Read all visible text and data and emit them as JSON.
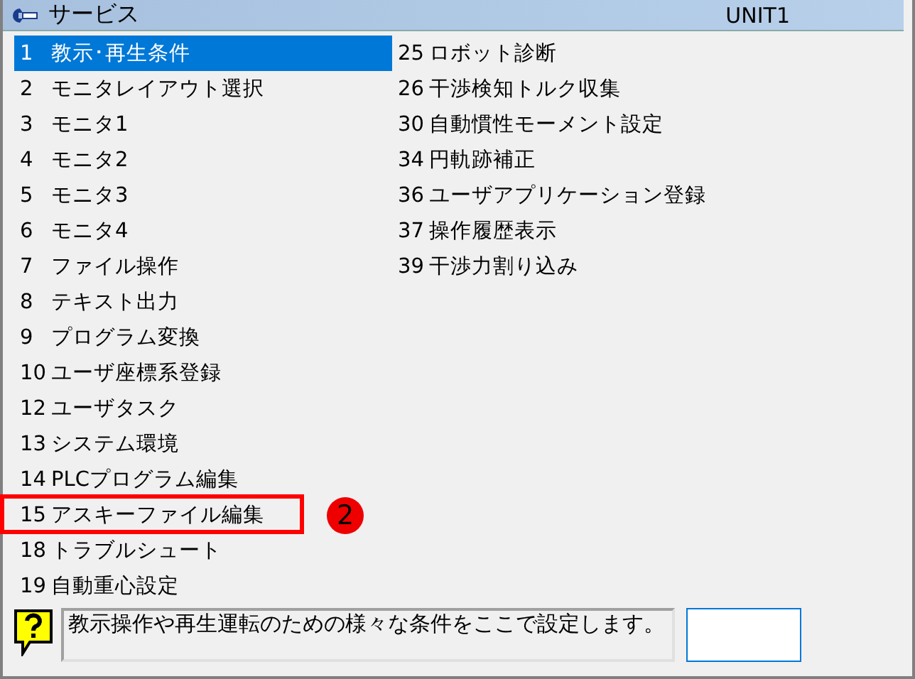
{
  "window": {
    "title": "サービス",
    "unit": "UNIT1"
  },
  "menu": {
    "columns": [
      [
        {
          "number": "1",
          "label": "教示･再生条件",
          "selected": true,
          "annotated": false
        },
        {
          "number": "2",
          "label": "モニタレイアウト選択",
          "selected": false,
          "annotated": false
        },
        {
          "number": "3",
          "label": "モニタ1",
          "selected": false,
          "annotated": false
        },
        {
          "number": "4",
          "label": "モニタ2",
          "selected": false,
          "annotated": false
        },
        {
          "number": "5",
          "label": "モニタ3",
          "selected": false,
          "annotated": false
        },
        {
          "number": "6",
          "label": "モニタ4",
          "selected": false,
          "annotated": false
        },
        {
          "number": "7",
          "label": "ファイル操作",
          "selected": false,
          "annotated": false
        },
        {
          "number": "8",
          "label": "テキスト出力",
          "selected": false,
          "annotated": false
        },
        {
          "number": "9",
          "label": "プログラム変換",
          "selected": false,
          "annotated": false
        },
        {
          "number": "10",
          "label": "ユーザ座標系登録",
          "selected": false,
          "annotated": false
        },
        {
          "number": "12",
          "label": "ユーザタスク",
          "selected": false,
          "annotated": false
        },
        {
          "number": "13",
          "label": "システム環境",
          "selected": false,
          "annotated": false
        },
        {
          "number": "14",
          "label": "PLCプログラム編集",
          "selected": false,
          "annotated": false
        },
        {
          "number": "15",
          "label": "アスキーファイル編集",
          "selected": false,
          "annotated": true
        },
        {
          "number": "18",
          "label": "トラブルシュート",
          "selected": false,
          "annotated": false
        },
        {
          "number": "19",
          "label": "自動重心設定",
          "selected": false,
          "annotated": false
        }
      ],
      [
        {
          "number": "25",
          "label": "ロボット診断",
          "selected": false,
          "annotated": false
        },
        {
          "number": "26",
          "label": "干渉検知トルク収集",
          "selected": false,
          "annotated": false
        },
        {
          "number": "30",
          "label": "自動慣性モーメント設定",
          "selected": false,
          "annotated": false
        },
        {
          "number": "34",
          "label": "円軌跡補正",
          "selected": false,
          "annotated": false
        },
        {
          "number": "36",
          "label": "ユーザアプリケーション登録",
          "selected": false,
          "annotated": false
        },
        {
          "number": "37",
          "label": "操作履歴表示",
          "selected": false,
          "annotated": false
        },
        {
          "number": "39",
          "label": "干渉力割り込み",
          "selected": false,
          "annotated": false
        }
      ]
    ]
  },
  "annotation": {
    "label": "2"
  },
  "help": {
    "message": "教示操作や再生運転のための様々な条件をここで設定します。"
  }
}
